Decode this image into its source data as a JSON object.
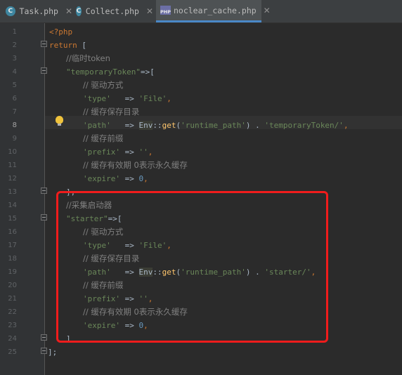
{
  "tabs": [
    {
      "icon": "C",
      "label": "Task.php",
      "close": "✕"
    },
    {
      "icon": "C",
      "label": "Collect.php",
      "close": "✕"
    },
    {
      "icon": "PHP",
      "label": "noclear_cache.php",
      "close": "✕"
    }
  ],
  "line_numbers": [
    "1",
    "2",
    "3",
    "4",
    "5",
    "6",
    "7",
    "8",
    "9",
    "10",
    "11",
    "12",
    "13",
    "14",
    "15",
    "16",
    "17",
    "18",
    "19",
    "20",
    "21",
    "22",
    "23",
    "24",
    "25"
  ],
  "code": {
    "l1": "<?php",
    "l2_kw": "return",
    "l2_rest": " [",
    "l3": "//临时token",
    "l4_str": "\"temporaryToken\"",
    "l4_rest": "=>[",
    "l5": "// 驱动方式",
    "l6_key": "'type'",
    "l6_op": "   => ",
    "l6_val": "'File'",
    "l6_end": ",",
    "l7": "// 缓存保存目录",
    "l8_key": "'path'",
    "l8_op": "   => ",
    "l8_cls": "Env",
    "l8_sep": "::",
    "l8_fn": "get",
    "l8_arg": "'runtime_path'",
    "l8_mid": ") . ",
    "l8_str": "'temporaryToken/'",
    "l8_end": ",",
    "l9": "// 缓存前缀",
    "l10_key": "'prefix'",
    "l10_op": " => ",
    "l10_val": "''",
    "l10_end": ",",
    "l11": "// 缓存有效期 0表示永久缓存",
    "l12_key": "'expire'",
    "l12_op": " => ",
    "l12_val": "0",
    "l12_end": ",",
    "l13": "],",
    "l14": "//采集启动器",
    "l15_str": "\"starter\"",
    "l15_rest": "=>[",
    "l16": "// 驱动方式",
    "l17_key": "'type'",
    "l17_op": "   => ",
    "l17_val": "'File'",
    "l17_end": ",",
    "l18": "// 缓存保存目录",
    "l19_key": "'path'",
    "l19_op": "   => ",
    "l19_cls": "Env",
    "l19_sep": "::",
    "l19_fn": "get",
    "l19_arg": "'runtime_path'",
    "l19_mid": ") . ",
    "l19_str": "'starter/'",
    "l19_end": ",",
    "l20": "// 缓存前缀",
    "l21_key": "'prefix'",
    "l21_op": " => ",
    "l21_val": "''",
    "l21_end": ",",
    "l22": "// 缓存有效期 0表示永久缓存",
    "l23_key": "'expire'",
    "l23_op": " => ",
    "l23_val": "0",
    "l23_end": ",",
    "l24": "]",
    "l25": "];"
  },
  "colors": {
    "keyword": "#cc7832",
    "string": "#6a8759",
    "number": "#6897bb",
    "comment": "#808080",
    "function": "#ffc66d",
    "highlight_box": "#f01c1c"
  }
}
